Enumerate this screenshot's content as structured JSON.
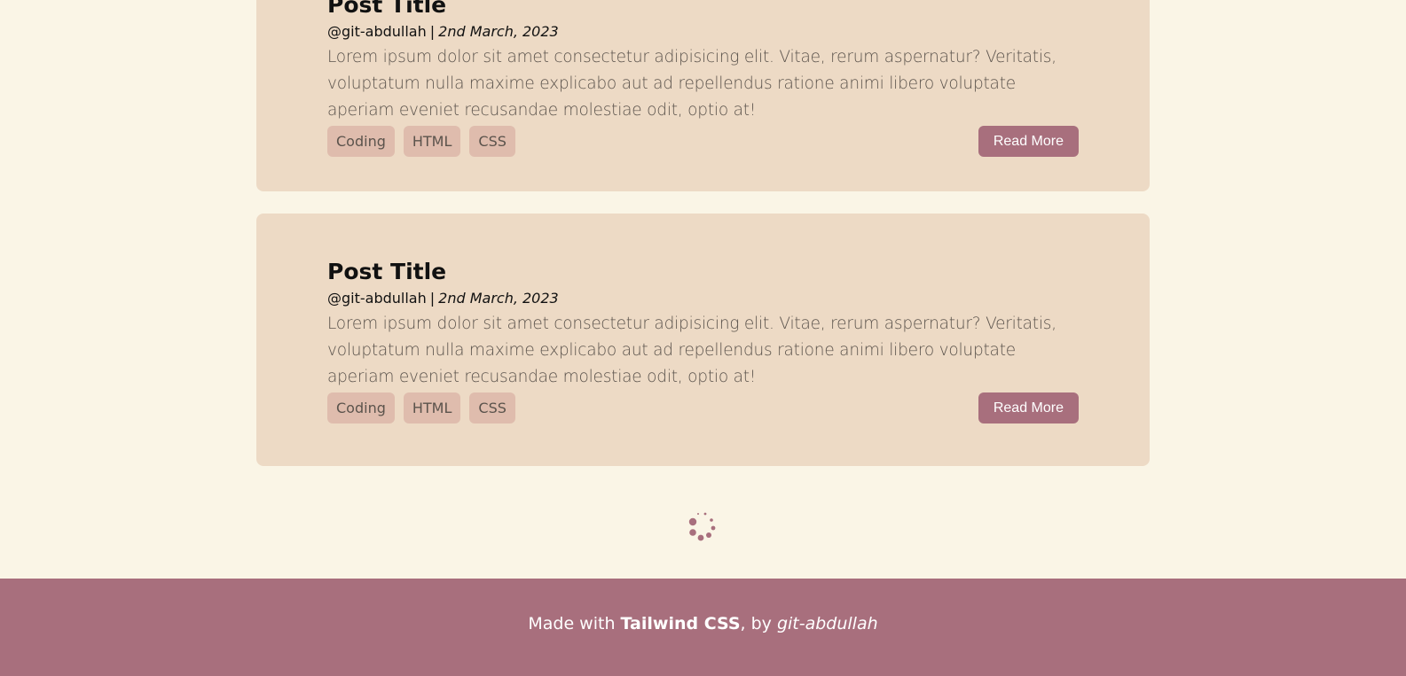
{
  "posts": [
    {
      "title": "Post Title",
      "author": "@git-abdullah",
      "separator": "|",
      "date": "2nd March, 2023",
      "excerpt": "Lorem ipsum dolor sit amet consectetur adipisicing elit. Vitae, rerum aspernatur? Veritatis, voluptatum nulla maxime explicabo aut ad repellendus ratione animi libero voluptate aperiam eveniet recusandae molestiae odit, optio at!",
      "tags": [
        "Coding",
        "HTML",
        "CSS"
      ],
      "button": "Read More"
    },
    {
      "title": "Post Title",
      "author": "@git-abdullah",
      "separator": "|",
      "date": "2nd March, 2023",
      "excerpt": "Lorem ipsum dolor sit amet consectetur adipisicing elit. Vitae, rerum aspernatur? Veritatis, voluptatum nulla maxime explicabo aut ad repellendus ratione animi libero voluptate aperiam eveniet recusandae molestiae odit, optio at!",
      "tags": [
        "Coding",
        "HTML",
        "CSS"
      ],
      "button": "Read More"
    }
  ],
  "loading": {
    "icon": "spinner-icon"
  },
  "footer": {
    "prefix": "Made with ",
    "brand": "Tailwind CSS",
    "middle": ", by ",
    "author": "git-abdullah"
  },
  "colors": {
    "background": "#faf5e6",
    "card": "#eddac5",
    "tag": "#dfbcad",
    "accent": "#a86f7d"
  }
}
